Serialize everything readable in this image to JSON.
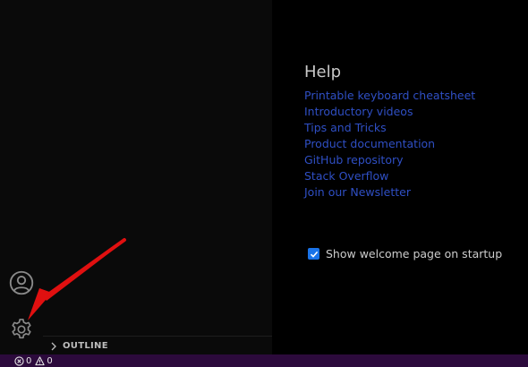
{
  "activity_bar": {
    "account_icon": "account-icon",
    "settings_icon": "gear-icon"
  },
  "sidebar": {
    "outline_label": "OUTLINE"
  },
  "welcome": {
    "help_title": "Help",
    "help_links": [
      "Printable keyboard cheatsheet",
      "Introductory videos",
      "Tips and Tricks",
      "Product documentation",
      "GitHub repository",
      "Stack Overflow",
      "Join our Newsletter"
    ],
    "show_on_startup_label": "Show welcome page on startup",
    "show_on_startup_checked": true
  },
  "status_bar": {
    "errors": "0",
    "warnings": "0"
  },
  "colors": {
    "link": "#2f4fc4",
    "status_bar_bg": "#2c0a3c",
    "annotation_arrow": "#e01010",
    "checkbox": "#1a73e8"
  }
}
